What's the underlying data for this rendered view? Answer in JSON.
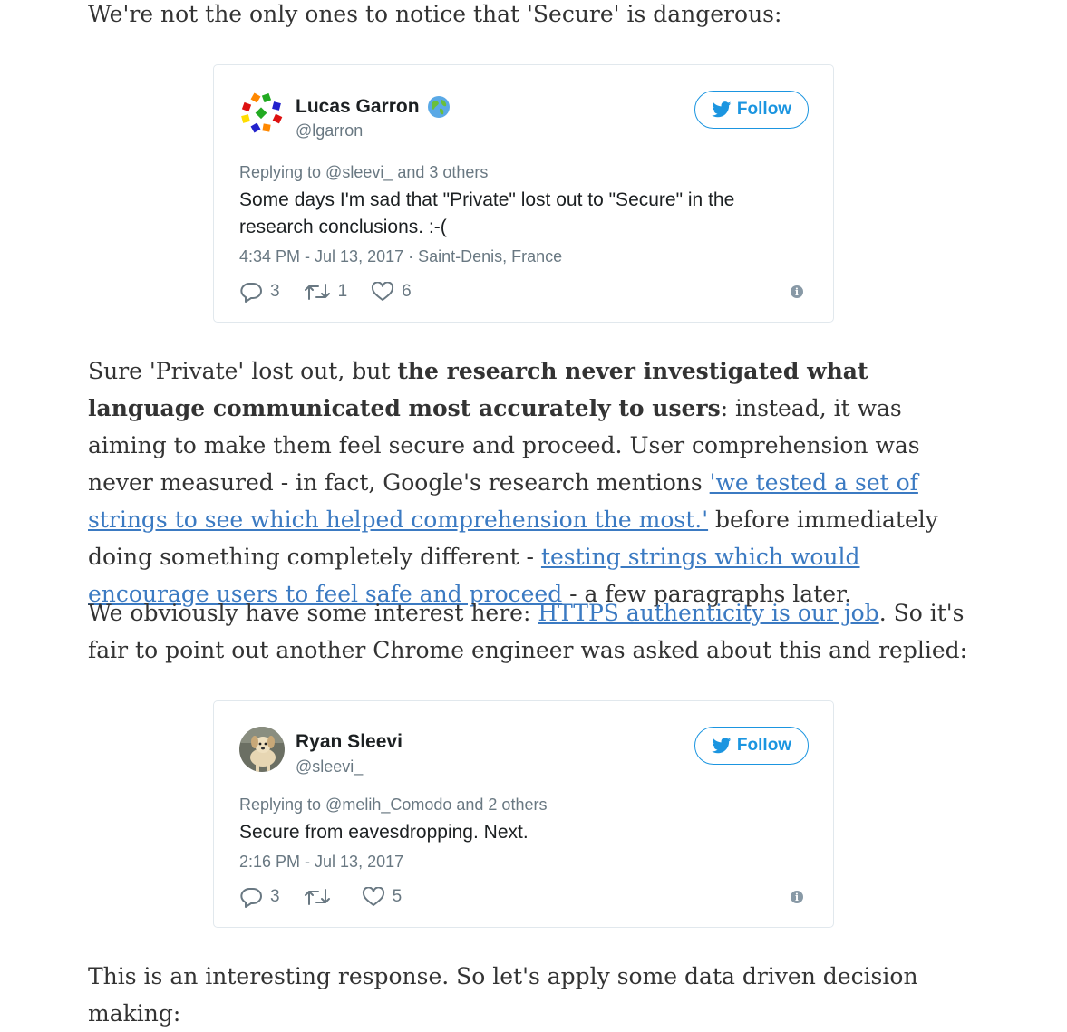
{
  "article": {
    "p1": "We're not the only ones to notice that 'Secure' is dangerous:",
    "p2": {
      "t1": "Sure 'Private' lost out, but ",
      "bold": "the research never investigated what language communicated most accurately to users",
      "t2": ": instead, it was aiming to make them feel secure and proceed. User comprehension was never measured - in fact, Google's research mentions ",
      "link1": "'we tested a set of strings to see which helped comprehension the most.'",
      "t3": " before immediately doing something completely different - ",
      "link2": "testing strings which would encourage users to feel safe and proceed",
      "t4": " - a few paragraphs later."
    },
    "p3": {
      "t1": "We obviously have some interest here: ",
      "link": "HTTPS authenticity is our job",
      "t2": ". So it's fair to point out another Chrome engineer was asked about this and replied:"
    },
    "p4": "This is an interesting response. So let's apply some data driven decision making:"
  },
  "tweets": [
    {
      "name": "Lucas Garron",
      "handle": "@lgarron",
      "follow_label": "Follow",
      "replying": "Replying to @sleevi_ and 3 others",
      "text": "Some days I'm sad that \"Private\" lost out to \"Secure\" in the research conclusions. :-(",
      "timestamp": "4:34 PM - Jul 13, 2017",
      "location": "Saint-Denis, France",
      "replies": "3",
      "retweets": "1",
      "likes": "6"
    },
    {
      "name": "Ryan Sleevi",
      "handle": "@sleevi_",
      "follow_label": "Follow",
      "replying": "Replying to @melih_Comodo and 2 others",
      "text": "Secure from eavesdropping. Next.",
      "timestamp": "2:16 PM - Jul 13, 2017",
      "replies": "3",
      "retweets": "",
      "likes": "5"
    }
  ],
  "colors": {
    "link": "#3b7ac2",
    "twitter_blue": "#1b95e0",
    "muted": "#697882"
  }
}
